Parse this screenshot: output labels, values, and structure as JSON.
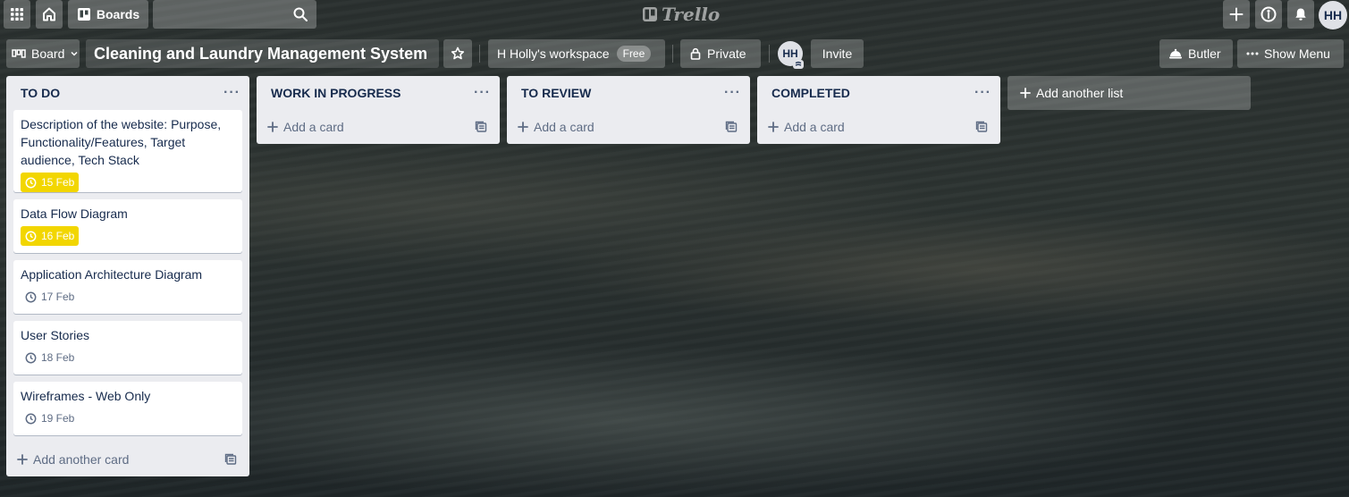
{
  "topbar": {
    "boards_label": "Boards",
    "logo_text": "Trello",
    "user_initials": "HH"
  },
  "board_header": {
    "view_label": "Board",
    "title": "Cleaning and Laundry Management System",
    "workspace_label": "H Holly's workspace",
    "workspace_badge": "Free",
    "visibility_label": "Private",
    "member_initials": "HH",
    "invite_label": "Invite",
    "butler_label": "Butler",
    "menu_label": "Show Menu"
  },
  "lists": [
    {
      "title": "TO DO",
      "cards": [
        {
          "title": "Description of the website: Purpose, Functionality/Features, Target audience, Tech Stack",
          "due": "15 Feb",
          "due_status": "soon"
        },
        {
          "title": "Data Flow Diagram",
          "due": "16 Feb",
          "due_status": "soon"
        },
        {
          "title": "Application Architecture Diagram",
          "due": "17 Feb",
          "due_status": "normal"
        },
        {
          "title": "User Stories",
          "due": "18 Feb",
          "due_status": "normal"
        },
        {
          "title": "Wireframes - Web Only",
          "due": "19 Feb",
          "due_status": "normal"
        }
      ],
      "add_label": "Add another card"
    },
    {
      "title": "WORK IN PROGRESS",
      "cards": [],
      "add_label": "Add a card"
    },
    {
      "title": "TO REVIEW",
      "cards": [],
      "add_label": "Add a card"
    },
    {
      "title": "COMPLETED",
      "cards": [],
      "add_label": "Add a card"
    }
  ],
  "add_list_label": "Add another list",
  "colors": {
    "due_soon": "#f2d600",
    "list_bg": "#ebecf0",
    "text": "#172b4d",
    "muted": "#5e6c84"
  },
  "icons": [
    "apps-icon",
    "home-icon",
    "boards-icon",
    "search-icon",
    "trello-logo-icon",
    "plus-icon",
    "info-icon",
    "bell-icon",
    "board-view-icon",
    "star-icon",
    "lock-icon",
    "butler-icon",
    "ellipsis-icon",
    "clock-icon",
    "template-icon"
  ]
}
